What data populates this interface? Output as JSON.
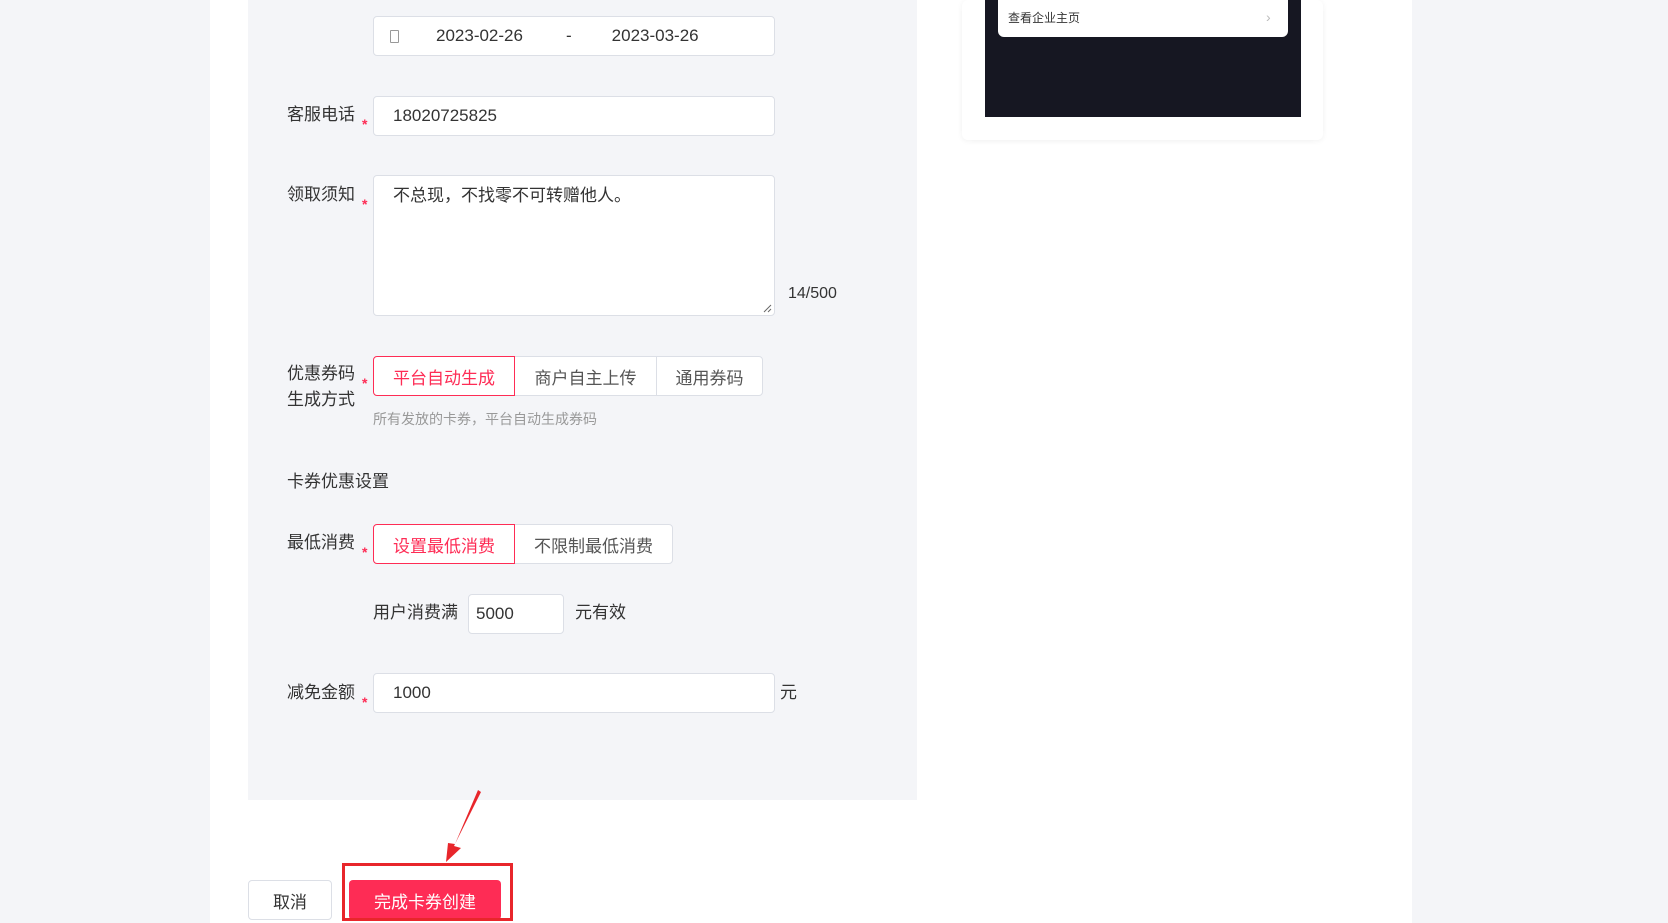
{
  "date_range": {
    "start": "2023-02-26",
    "separator": "-",
    "end": "2023-03-26"
  },
  "service_phone": {
    "label": "客服电话",
    "required_mark": "*",
    "value": "18020725825"
  },
  "pickup_notice": {
    "label": "领取须知",
    "required_mark": "*",
    "value": "不总现，不找零不可转赠他人。",
    "counter": "14/500"
  },
  "code_generation": {
    "label_line1": "优惠券码",
    "label_line2": "生成方式",
    "required_mark": "*",
    "options": [
      {
        "label": "平台自动生成",
        "selected": true
      },
      {
        "label": "商户自主上传",
        "selected": false
      },
      {
        "label": "通用券码",
        "selected": false
      }
    ],
    "hint": "所有发放的卡券，平台自动生成券码"
  },
  "discount_settings": {
    "title": "卡券优惠设置"
  },
  "min_spend": {
    "label": "最低消费",
    "required_mark": "*",
    "options": [
      {
        "label": "设置最低消费",
        "selected": true
      },
      {
        "label": "不限制最低消费",
        "selected": false
      }
    ],
    "prefix": "用户消费满",
    "value": "5000",
    "suffix": "元有效"
  },
  "discount_amount": {
    "label": "减免金额",
    "required_mark": "*",
    "value": "1000",
    "unit": "元"
  },
  "actions": {
    "cancel": "取消",
    "submit": "完成卡券创建"
  },
  "preview": {
    "row_label": "查看企业主页",
    "row_icon": "chevron-right-icon"
  },
  "colors": {
    "accent": "#fe2c55",
    "annotation": "#e8262b",
    "panel_bg": "#f4f5f8",
    "phone_bg": "#161722"
  }
}
